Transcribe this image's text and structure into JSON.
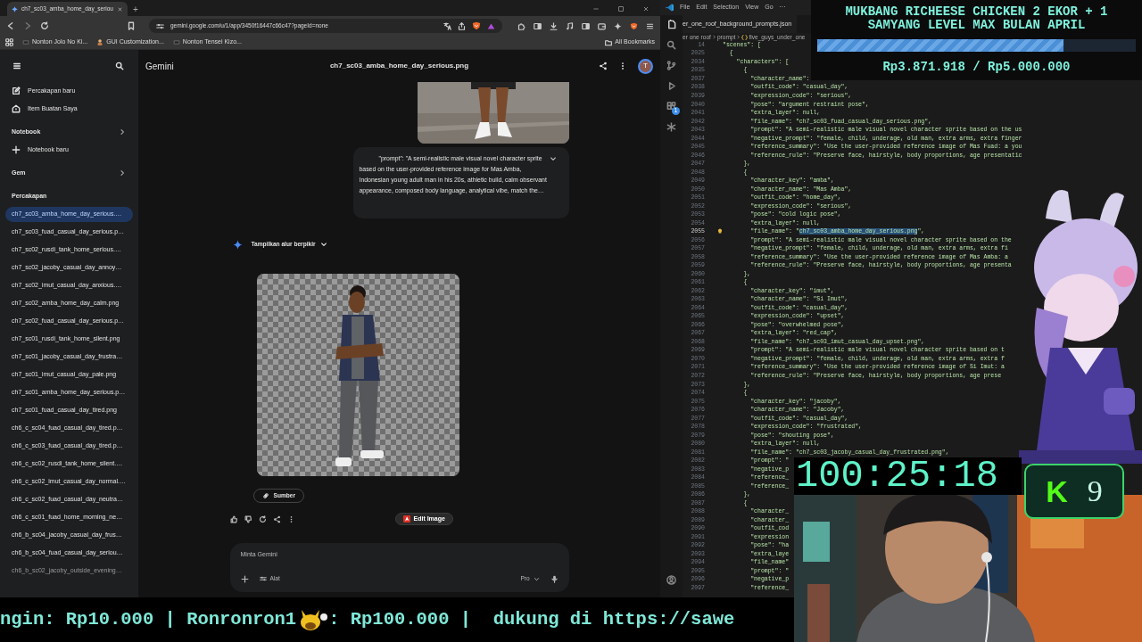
{
  "browser": {
    "tab_title": "ch7_sc03_amba_home_day_seriou",
    "new_tab": "+",
    "url": "gemini.google.com/u/1/app/3450f16447c66c47?pageId=none",
    "bookmarks": [
      "Nonton Jolo No Ki...",
      "GUI Customization...",
      "Nonton Tensei Kizo..."
    ],
    "all_bookmarks": "All Bookmarks"
  },
  "gemini": {
    "brand": "Gemini",
    "title": "ch7_sc03_amba_home_day_serious.png",
    "avatar": "T",
    "sidebar": [
      {
        "kind": "new_chat",
        "label": "Percakapan baru"
      },
      {
        "kind": "my_items",
        "label": "Item Buatan Saya"
      },
      {
        "kind": "heading",
        "label": "Notebook",
        "chevron": true
      },
      {
        "kind": "new_notebook",
        "label": "Notebook baru"
      },
      {
        "kind": "heading",
        "label": "Gem",
        "chevron": true
      },
      {
        "kind": "heading",
        "label": "Percakapan",
        "chevron": false
      }
    ],
    "conversations": [
      {
        "title": "ch7_sc03_amba_home_day_serious.…",
        "selected": true,
        "faded": false
      },
      {
        "title": "ch7_sc03_fuad_casual_day_serious.p…",
        "selected": false,
        "faded": false
      },
      {
        "title": "ch7_sc02_rusdi_tank_home_serious.…",
        "selected": false,
        "faded": false
      },
      {
        "title": "ch7_sc02_jacoby_casual_day_annoy…",
        "selected": false,
        "faded": false
      },
      {
        "title": "ch7_sc02_imut_casual_day_anxious.…",
        "selected": false,
        "faded": false
      },
      {
        "title": "ch7_sc02_amba_home_day_calm.png",
        "selected": false,
        "faded": false
      },
      {
        "title": "ch7_sc02_fuad_casual_day_serious.p…",
        "selected": false,
        "faded": false
      },
      {
        "title": "ch7_sc01_rusdi_tank_home_silent.png",
        "selected": false,
        "faded": false
      },
      {
        "title": "ch7_sc01_jacoby_casual_day_frustra…",
        "selected": false,
        "faded": false
      },
      {
        "title": "ch7_sc01_imut_casual_day_pale.png",
        "selected": false,
        "faded": false
      },
      {
        "title": "ch7_sc01_amba_home_day_serious.p…",
        "selected": false,
        "faded": false
      },
      {
        "title": "ch7_sc01_fuad_casual_day_tired.png",
        "selected": false,
        "faded": false
      },
      {
        "title": "ch6_c_sc04_fuad_casual_day_tired.p…",
        "selected": false,
        "faded": false
      },
      {
        "title": "ch6_c_sc03_fuad_casual_day_tired.p…",
        "selected": false,
        "faded": false
      },
      {
        "title": "ch6_c_sc02_rusdi_tank_home_silent.…",
        "selected": false,
        "faded": false
      },
      {
        "title": "ch6_c_sc02_imut_casual_day_normal.…",
        "selected": false,
        "faded": false
      },
      {
        "title": "ch6_c_sc02_fuad_casual_day_neutra…",
        "selected": false,
        "faded": false
      },
      {
        "title": "ch6_c_sc01_fuad_home_morning_ne…",
        "selected": false,
        "faded": false
      },
      {
        "title": "ch6_b_sc04_jacoby_casual_day_frus…",
        "selected": false,
        "faded": false
      },
      {
        "title": "ch6_b_sc04_fuad_casual_day_seriou…",
        "selected": false,
        "faded": false
      },
      {
        "title": "ch6_b_sc02_jacoby_outside_evening…",
        "selected": false,
        "faded": true
      }
    ],
    "prompt": "\"prompt\": \"A semi-realistic male visual novel character sprite based on the user-provided reference image for Mas Amba, Indonesian young adult man in his 20s, athletic build, calm observant appearance, composed body language, analytical vibe, match the…",
    "thinking": "Tampilkan alur berpikir",
    "source_button": "Sumber",
    "edit_button": "Edit Image",
    "input": {
      "placeholder": "Minta Gemini",
      "tools": "Alat",
      "model": "Pro"
    }
  },
  "editor": {
    "menu": [
      "File",
      "Edit",
      "Selection",
      "View",
      "Go",
      "···"
    ],
    "extensions_badge": "1",
    "tab": "er_one_roof_background_prompts.json",
    "breadcrumb": [
      "er one roof",
      "prompt",
      "five_guys_under_one"
    ],
    "sticky_lines": [
      {
        "n": "14",
        "text": "\"scenes\": ["
      },
      {
        "n": "2025",
        "text": "  {"
      },
      {
        "n": "2034",
        "text": "    \"characters\": ["
      },
      {
        "n": "2035",
        "text": "      {"
      }
    ],
    "lines": [
      {
        "n": "2037",
        "text": "        \"character_name\":",
        "active": false
      },
      {
        "n": "2038",
        "text": "        \"outfit_code\": \"casual_day\",",
        "active": false
      },
      {
        "n": "2039",
        "text": "        \"expression_code\": \"serious\",",
        "active": false
      },
      {
        "n": "2040",
        "text": "        \"pose\": \"argument restraint pose\",",
        "active": false
      },
      {
        "n": "2041",
        "text": "        \"extra_layer\": null,",
        "active": false
      },
      {
        "n": "2042",
        "text": "        \"file_name\": \"ch7_sc03_fuad_casual_day_serious.png\",",
        "active": false
      },
      {
        "n": "2043",
        "text": "        \"prompt\": \"A semi-realistic male visual novel character sprite based on the us",
        "active": false
      },
      {
        "n": "2044",
        "text": "        \"negative_prompt\": \"female, child, underage, old man, extra arms, extra finger",
        "active": false
      },
      {
        "n": "2045",
        "text": "        \"reference_summary\": \"Use the user-provided reference image of Mas Fuad: a you",
        "active": false
      },
      {
        "n": "2046",
        "text": "        \"reference_rule\": \"Preserve face, hairstyle, body proportions, age presentatic",
        "active": false
      },
      {
        "n": "2047",
        "text": "      },",
        "active": false
      },
      {
        "n": "2048",
        "text": "      {",
        "active": false
      },
      {
        "n": "2049",
        "text": "        \"character_key\": \"amba\",",
        "active": false
      },
      {
        "n": "2050",
        "text": "        \"character_name\": \"Mas Amba\",",
        "active": false
      },
      {
        "n": "2051",
        "text": "        \"outfit_code\": \"home_day\",",
        "active": false
      },
      {
        "n": "2052",
        "text": "        \"expression_code\": \"serious\",",
        "active": false
      },
      {
        "n": "2053",
        "text": "        \"pose\": \"cold logic pose\",",
        "active": false
      },
      {
        "n": "2054",
        "text": "        \"extra_layer\": null,",
        "active": false
      },
      {
        "n": "2055",
        "text": "        \"file_name\": \"",
        "selection": "ch7_sc03_amba_home_day_serious.png",
        "after": "\",",
        "active": true
      },
      {
        "n": "2056",
        "text": "        \"prompt\": \"A semi-realistic male visual novel character sprite based on the",
        "active": false
      },
      {
        "n": "2057",
        "text": "        \"negative_prompt\": \"female, child, underage, old man, extra arms, extra fi",
        "active": false
      },
      {
        "n": "2058",
        "text": "        \"reference_summary\": \"Use the user-provided reference image of Mas Amba: a",
        "active": false
      },
      {
        "n": "2059",
        "text": "        \"reference_rule\": \"Preserve face, hairstyle, body proportions, age presenta",
        "active": false
      },
      {
        "n": "2060",
        "text": "      },",
        "active": false
      },
      {
        "n": "2061",
        "text": "      {",
        "active": false
      },
      {
        "n": "2062",
        "text": "        \"character_key\": \"imut\",",
        "active": false
      },
      {
        "n": "2063",
        "text": "        \"character_name\": \"Si Imut\",",
        "active": false
      },
      {
        "n": "2064",
        "text": "        \"outfit_code\": \"casual_day\",",
        "active": false
      },
      {
        "n": "2065",
        "text": "        \"expression_code\": \"upset\",",
        "active": false
      },
      {
        "n": "2066",
        "text": "        \"pose\": \"overwhelmed pose\",",
        "active": false
      },
      {
        "n": "2067",
        "text": "        \"extra_layer\": \"red_cap\",",
        "active": false
      },
      {
        "n": "2068",
        "text": "        \"file_name\": \"ch7_sc03_imut_casual_day_upset.png\",",
        "active": false
      },
      {
        "n": "2069",
        "text": "        \"prompt\": \"A semi-realistic male visual novel character sprite based on t",
        "active": false
      },
      {
        "n": "2070",
        "text": "        \"negative_prompt\": \"female, child, underage, old man, extra arms, extra f",
        "active": false
      },
      {
        "n": "2071",
        "text": "        \"reference_summary\": \"Use the user-provided reference image of Si Imut: a",
        "active": false
      },
      {
        "n": "2072",
        "text": "        \"reference_rule\": \"Preserve face, hairstyle, body proportions, age prese",
        "active": false
      },
      {
        "n": "2073",
        "text": "      },",
        "active": false
      },
      {
        "n": "2074",
        "text": "      {",
        "active": false
      },
      {
        "n": "2075",
        "text": "        \"character_key\": \"jacoby\",",
        "active": false
      },
      {
        "n": "2076",
        "text": "        \"character_name\": \"Jacoby\",",
        "active": false
      },
      {
        "n": "2077",
        "text": "        \"outfit_code\": \"casual_day\",",
        "active": false
      },
      {
        "n": "2078",
        "text": "        \"expression_code\": \"frustrated\",",
        "active": false
      },
      {
        "n": "2079",
        "text": "        \"pose\": \"shouting pose\",",
        "active": false
      },
      {
        "n": "2080",
        "text": "        \"extra_layer\": null,",
        "active": false
      },
      {
        "n": "2081",
        "text": "        \"file_name\": \"ch7_sc03_jacoby_casual_day_frustrated.png\",",
        "active": false
      },
      {
        "n": "2082",
        "text": "        \"prompt\": \"",
        "active": false
      },
      {
        "n": "2083",
        "text": "        \"negative_p",
        "active": false
      },
      {
        "n": "2084",
        "text": "        \"reference_",
        "active": false
      },
      {
        "n": "2085",
        "text": "        \"reference_",
        "active": false
      },
      {
        "n": "2086",
        "text": "      },",
        "active": false
      },
      {
        "n": "2087",
        "text": "      {",
        "active": false
      },
      {
        "n": "2088",
        "text": "        \"character_",
        "active": false
      },
      {
        "n": "2089",
        "text": "        \"character_",
        "active": false
      },
      {
        "n": "2090",
        "text": "        \"outfit_cod",
        "active": false
      },
      {
        "n": "2091",
        "text": "        \"expression",
        "active": false
      },
      {
        "n": "2092",
        "text": "        \"pose\": \"ha",
        "active": false
      },
      {
        "n": "2093",
        "text": "        \"extra_laye",
        "active": false
      },
      {
        "n": "2094",
        "text": "        \"file_name\"",
        "active": false
      },
      {
        "n": "2095",
        "text": "        \"prompt\": \"",
        "active": false
      },
      {
        "n": "2096",
        "text": "        \"negative_p",
        "active": false
      },
      {
        "n": "2097",
        "text": "        \"reference_",
        "active": false
      }
    ]
  },
  "overlay": {
    "goal": {
      "title_lines": [
        "MUKBANG RICHEESE CHICKEN 2 EKOR + 1",
        "SAMYANG LEVEL MAX BULAN APRIL"
      ],
      "level": 0.774,
      "amount": "Rp3.871.918 / Rp5.000.000"
    },
    "timer": "100:25:18",
    "counter": {
      "logo": "K",
      "value": "9"
    },
    "ticker": {
      "before": "ngin: Rp10.000 | Ronronron1",
      "after": ": Rp100.000 |  dukung di https://sawe"
    }
  }
}
